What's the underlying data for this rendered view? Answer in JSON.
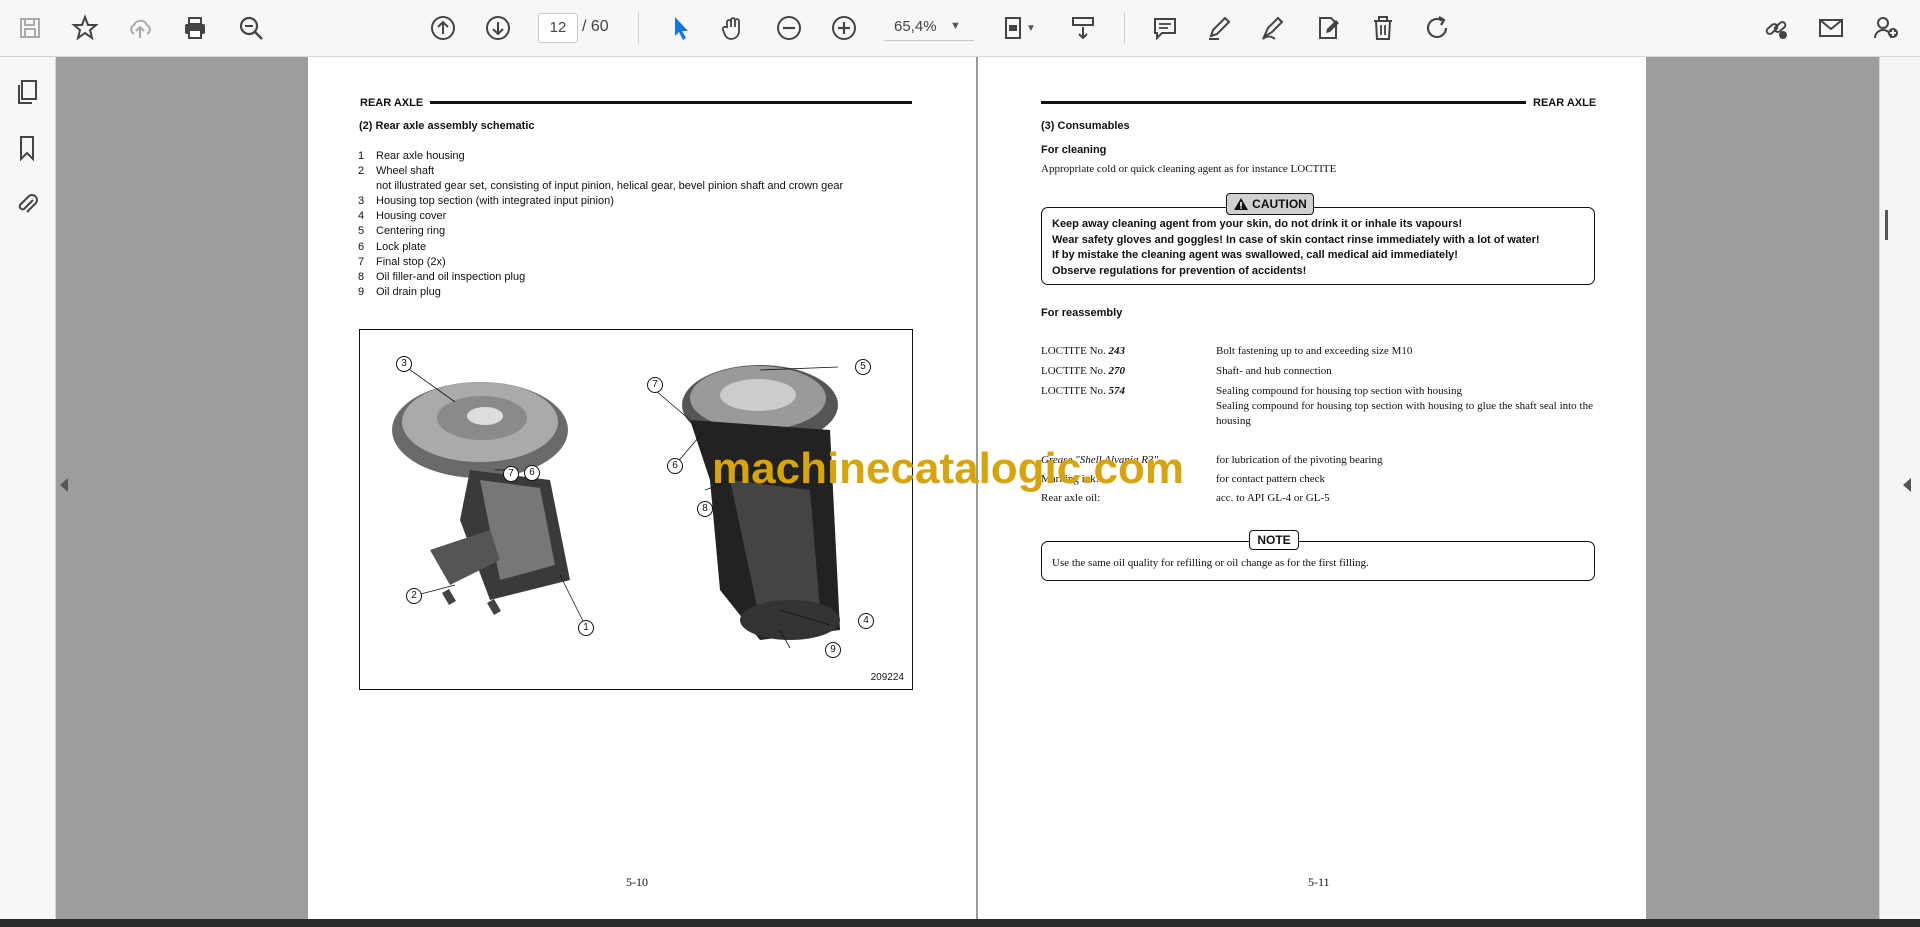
{
  "toolbar": {
    "page_current": "12",
    "page_total": "60",
    "zoom": "65,4%"
  },
  "left_page": {
    "header": "REAR AXLE",
    "section": "(2)  Rear axle assembly schematic",
    "items": [
      {
        "n": "1",
        "text": "Rear axle housing"
      },
      {
        "n": "2",
        "text": "Wheel shaft"
      },
      {
        "n": "",
        "text": "not illustrated gear set, consisting of input pinion, helical gear, bevel pinion shaft and crown gear"
      },
      {
        "n": "3",
        "text": "Housing top section (with integrated input pinion)"
      },
      {
        "n": "4",
        "text": "Housing cover"
      },
      {
        "n": "5",
        "text": "Centering ring"
      },
      {
        "n": "6",
        "text": "Lock plate"
      },
      {
        "n": "7",
        "text": "Final stop (2x)"
      },
      {
        "n": "8",
        "text": "Oil filler-and oil inspection plug"
      },
      {
        "n": "9",
        "text": "Oil drain plug"
      }
    ],
    "figure_id": "209224",
    "callouts": [
      "3",
      "7",
      "6",
      "2",
      "1",
      "7",
      "6",
      "8",
      "5",
      "4",
      "9"
    ],
    "page_number": "5-10"
  },
  "right_page": {
    "header": "REAR AXLE",
    "section": "(3)  Consumables",
    "cleaning_title": "For cleaning",
    "cleaning_text": "Appropriate cold or quick cleaning agent as for instance LOCTITE",
    "caution_label": "CAUTION",
    "caution_lines": [
      "Keep away cleaning agent from your skin, do not drink it or inhale its vapours!",
      "Wear safety gloves and goggles!  In case of skin contact rinse immediately with a lot of water!",
      "If by mistake the cleaning agent was swallowed, call medical aid immediately!",
      "Observe regulations for prevention of accidents!"
    ],
    "reassembly_title": "For reassembly",
    "loctite": [
      {
        "prefix": "LOCTITE No. ",
        "num": "243",
        "desc": "Bolt fastening up to and exceeding size M10"
      },
      {
        "prefix": "LOCTITE No. ",
        "num": "270",
        "desc": "Shaft- and hub connection"
      },
      {
        "prefix": "LOCTITE No. ",
        "num": "574",
        "desc": "Sealing compound for housing top section with housing"
      },
      {
        "prefix": "",
        "num": "",
        "desc": "Sealing compound for housing top section with housing to glue the shaft seal into the housing"
      }
    ],
    "grease_label": "Grease \"Shell Alvania R3\"",
    "grease_desc": "for lubrication of the pivoting bearing",
    "marking_label": "Marking ink:",
    "marking_desc": "for contact pattern check",
    "oil_label": "Rear axle oil:",
    "oil_desc": "acc. to API GL-4 or GL-5",
    "note_label": "NOTE",
    "note_text": "Use the same oil quality for refilling or oil change as for the first filling.",
    "page_number": "5-11"
  },
  "watermark": "machinecatalogic.com"
}
